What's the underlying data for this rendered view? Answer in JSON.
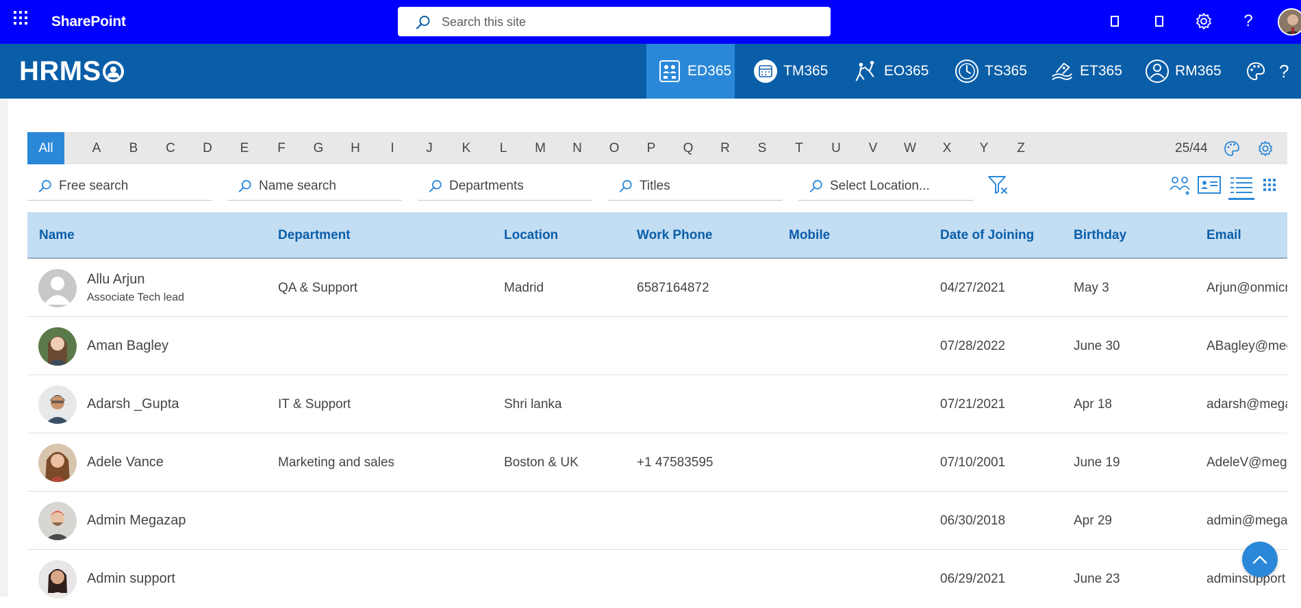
{
  "suitebar": {
    "title": "SharePoint",
    "search_placeholder": "Search this site",
    "help_glyph": "?"
  },
  "appbar": {
    "logo": "HRMS",
    "modules": [
      {
        "label": "ED365",
        "icon": "employee-directory-icon"
      },
      {
        "label": "TM365",
        "icon": "calendar-icon"
      },
      {
        "label": "EO365",
        "icon": "onboarding-icon"
      },
      {
        "label": "TS365",
        "icon": "clock-icon"
      },
      {
        "label": "ET365",
        "icon": "expense-icon"
      },
      {
        "label": "RM365",
        "icon": "person-icon"
      }
    ],
    "help_glyph": "?"
  },
  "alphabet": {
    "all_label": "All",
    "letters": [
      "A",
      "B",
      "C",
      "D",
      "E",
      "F",
      "G",
      "H",
      "I",
      "J",
      "K",
      "L",
      "M",
      "N",
      "O",
      "P",
      "Q",
      "R",
      "S",
      "T",
      "U",
      "V",
      "W",
      "X",
      "Y",
      "Z"
    ],
    "count": "25/44"
  },
  "filters": {
    "free_search": "Free search",
    "name_search": "Name search",
    "departments": "Departments",
    "titles": "Titles",
    "location": "Select Location..."
  },
  "table": {
    "columns": [
      "Name",
      "Department",
      "Location",
      "Work Phone",
      "Mobile",
      "Date of Joining",
      "Birthday",
      "Email"
    ],
    "rows": [
      {
        "name": "Allu Arjun",
        "title": "Associate Tech lead",
        "department": "QA & Support",
        "location": "Madrid",
        "work_phone": "6587164872",
        "mobile": "",
        "doj": "04/27/2021",
        "birthday": "May 3",
        "email": "Arjun@onmicr"
      },
      {
        "name": "Aman Bagley",
        "title": "",
        "department": "",
        "location": "",
        "work_phone": "",
        "mobile": "",
        "doj": "07/28/2022",
        "birthday": "June 30",
        "email": "ABagley@meg"
      },
      {
        "name": "Adarsh _Gupta",
        "title": "",
        "department": "IT & Support",
        "location": "Shri lanka",
        "work_phone": "",
        "mobile": "",
        "doj": "07/21/2021",
        "birthday": "Apr 18",
        "email": "adarsh@mega"
      },
      {
        "name": "Adele Vance",
        "title": "",
        "department": "Marketing and sales",
        "location": "Boston & UK",
        "work_phone": "+1 47583595",
        "mobile": "",
        "doj": "07/10/2001",
        "birthday": "June 19",
        "email": "AdeleV@mega"
      },
      {
        "name": "Admin Megazap",
        "title": "",
        "department": "",
        "location": "",
        "work_phone": "",
        "mobile": "",
        "doj": "06/30/2018",
        "birthday": "Apr 29",
        "email": "admin@mega."
      },
      {
        "name": "Admin support",
        "title": "",
        "department": "",
        "location": "",
        "work_phone": "",
        "mobile": "",
        "doj": "06/29/2021",
        "birthday": "June 23",
        "email": "adminsupport"
      }
    ]
  },
  "colors": {
    "suitebar": "#0000ff",
    "appbar": "#0a5ea8",
    "accent": "#2b88d8",
    "header_bg": "#c3ddf3"
  }
}
